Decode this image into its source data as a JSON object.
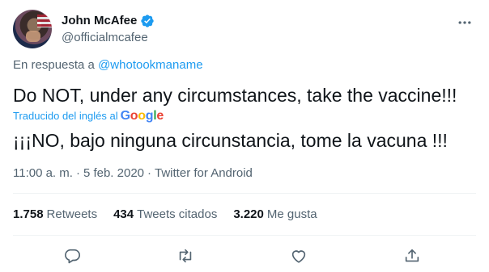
{
  "colors": {
    "accent": "#1d9bf0",
    "text_primary": "#0f1419",
    "text_secondary": "#536471",
    "divider": "#eff3f4"
  },
  "author": {
    "display_name": "John McAfee",
    "handle": "@officialmcafee",
    "verified_icon": "verified-badge-icon",
    "avatar": "profile-photo"
  },
  "reply": {
    "prefix": "En respuesta a",
    "mention": "@whotookmaname"
  },
  "tweet": {
    "text": "Do NOT, under any circumstances, take the vaccine!!!",
    "translation_label": "Traducido del inglés al",
    "translation_provider": "Google",
    "translated_text": "¡¡¡NO, bajo ninguna circunstancia, tome la vacuna !!!"
  },
  "meta": {
    "time": "11:00 a. m.",
    "separator": "·",
    "date": "5 feb. 2020",
    "source": "Twitter for Android"
  },
  "stats": [
    {
      "count": "1.758",
      "label": "Retweets"
    },
    {
      "count": "434",
      "label": "Tweets citados"
    },
    {
      "count": "3.220",
      "label": "Me gusta"
    }
  ],
  "actions": [
    {
      "icon": "reply-icon"
    },
    {
      "icon": "retweet-icon"
    },
    {
      "icon": "like-icon"
    },
    {
      "icon": "share-icon"
    }
  ]
}
